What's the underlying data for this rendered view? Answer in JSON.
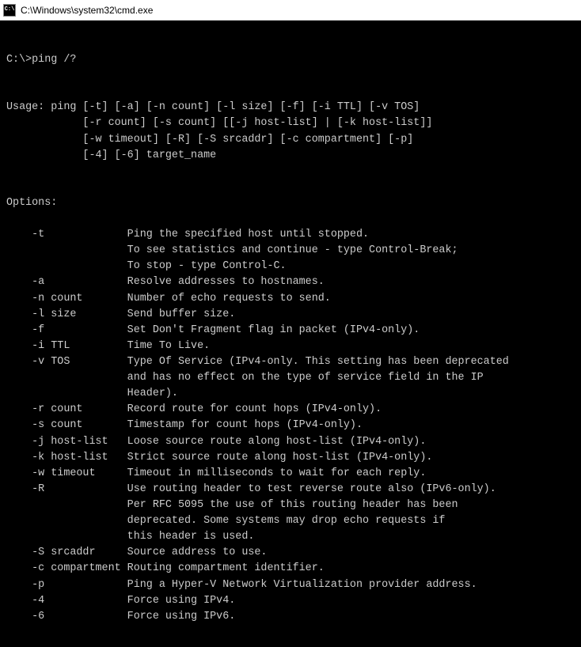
{
  "window": {
    "title": "C:\\Windows\\system32\\cmd.exe",
    "icon_label": "C:\\"
  },
  "terminal": {
    "prompt": "C:\\>ping /?",
    "usage_label": "Usage: ",
    "usage_lines": [
      "ping [-t] [-a] [-n count] [-l size] [-f] [-i TTL] [-v TOS]",
      "     [-r count] [-s count] [[-j host-list] | [-k host-list]]",
      "     [-w timeout] [-R] [-S srcaddr] [-c compartment] [-p]",
      "     [-4] [-6] target_name"
    ],
    "options_header": "Options:",
    "options": [
      {
        "flag": "-t",
        "desc": "Ping the specified host until stopped.\nTo see statistics and continue - type Control-Break;\nTo stop - type Control-C."
      },
      {
        "flag": "-a",
        "desc": "Resolve addresses to hostnames."
      },
      {
        "flag": "-n count",
        "desc": "Number of echo requests to send."
      },
      {
        "flag": "-l size",
        "desc": "Send buffer size."
      },
      {
        "flag": "-f",
        "desc": "Set Don't Fragment flag in packet (IPv4-only)."
      },
      {
        "flag": "-i TTL",
        "desc": "Time To Live."
      },
      {
        "flag": "-v TOS",
        "desc": "Type Of Service (IPv4-only. This setting has been deprecated\nand has no effect on the type of service field in the IP\nHeader)."
      },
      {
        "flag": "-r count",
        "desc": "Record route for count hops (IPv4-only)."
      },
      {
        "flag": "-s count",
        "desc": "Timestamp for count hops (IPv4-only)."
      },
      {
        "flag": "-j host-list",
        "desc": "Loose source route along host-list (IPv4-only)."
      },
      {
        "flag": "-k host-list",
        "desc": "Strict source route along host-list (IPv4-only)."
      },
      {
        "flag": "-w timeout",
        "desc": "Timeout in milliseconds to wait for each reply."
      },
      {
        "flag": "-R",
        "desc": "Use routing header to test reverse route also (IPv6-only).\nPer RFC 5095 the use of this routing header has been\ndeprecated. Some systems may drop echo requests if\nthis header is used."
      },
      {
        "flag": "-S srcaddr",
        "desc": "Source address to use."
      },
      {
        "flag": "-c compartment",
        "desc": "Routing compartment identifier."
      },
      {
        "flag": "-p",
        "desc": "Ping a Hyper-V Network Virtualization provider address."
      },
      {
        "flag": "-4",
        "desc": "Force using IPv4."
      },
      {
        "flag": "-6",
        "desc": "Force using IPv6."
      }
    ]
  }
}
